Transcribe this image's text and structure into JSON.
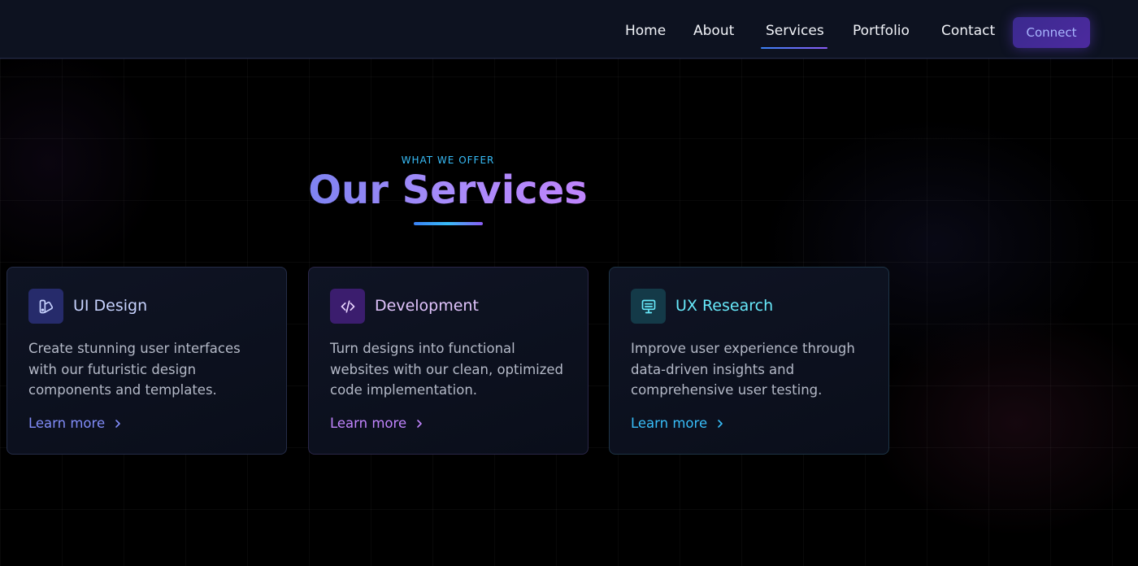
{
  "nav": {
    "links": [
      {
        "label": "Home"
      },
      {
        "label": "About"
      },
      {
        "label": "Services",
        "active": true
      },
      {
        "label": "Portfolio"
      },
      {
        "label": "Contact"
      }
    ],
    "cta_label": "Connect"
  },
  "section": {
    "eyebrow": "WHAT WE OFFER",
    "title": "Our Services"
  },
  "cards": [
    {
      "icon": "palette-icon",
      "title": "UI Design",
      "description": "Create stunning user interfaces with our futuristic design components and templates.",
      "link_label": "Learn more",
      "accent": "#818cf8"
    },
    {
      "icon": "code-icon",
      "title": "Development",
      "description": "Turn designs into functional websites with our clean, optimized code implementation.",
      "link_label": "Learn more",
      "accent": "#c084fc"
    },
    {
      "icon": "monitor-icon",
      "title": "UX Research",
      "description": "Improve user experience through data-driven insights and comprehensive user testing.",
      "link_label": "Learn more",
      "accent": "#38bdf8"
    }
  ]
}
